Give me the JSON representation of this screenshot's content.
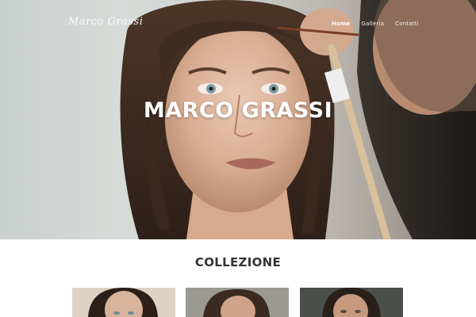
{
  "header": {
    "logo_text": "Marco Grassi",
    "nav": [
      {
        "label": "Home",
        "active": true
      },
      {
        "label": "Galleria",
        "active": false
      },
      {
        "label": "Contatti",
        "active": false
      }
    ]
  },
  "hero": {
    "title": "MARCO GRASSI"
  },
  "collection": {
    "title": "COLLEZIONE",
    "items": [
      {
        "name": "portrait-thumb-1"
      },
      {
        "name": "portrait-thumb-2"
      },
      {
        "name": "portrait-thumb-3"
      }
    ]
  },
  "colors": {
    "text_dark": "#333333",
    "nav_text": "#f1f1f1",
    "background": "#ffffff"
  }
}
